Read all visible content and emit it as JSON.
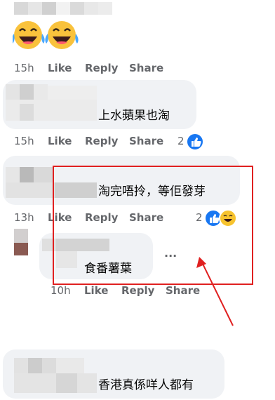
{
  "comments": [
    {
      "time": "15h",
      "like": "Like",
      "reply": "Reply",
      "share": "Share"
    },
    {
      "text": "上水蘋果也淘",
      "time": "15h",
      "like": "Like",
      "reply": "Reply",
      "share": "Share",
      "reaction_count": "2",
      "reactions": [
        "like-icon"
      ]
    },
    {
      "text": "淘完唔拎，等佢發芽",
      "time": "13h",
      "like": "Like",
      "reply": "Reply",
      "share": "Share",
      "reaction_count": "2",
      "reactions": [
        "like-icon",
        "haha-icon"
      ]
    },
    {
      "text": "食番薯葉",
      "time": "10h",
      "like": "Like",
      "reply": "Reply",
      "share": "Share",
      "more": "···"
    },
    {
      "text": "香港真係咩人都有"
    }
  ],
  "colors": {
    "annotation": "#e02020",
    "bubble": "#f0f2f5",
    "meta": "#65676b",
    "like_blue": "#1877f2"
  }
}
